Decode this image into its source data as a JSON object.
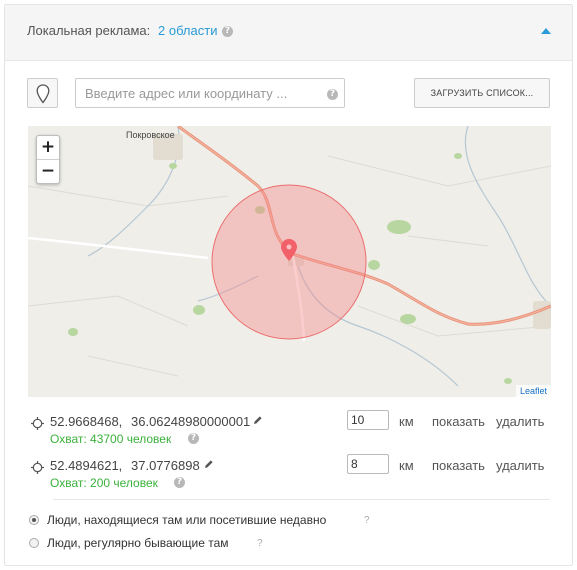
{
  "header": {
    "title": "Локальная реклама:",
    "regions_link": "2 области",
    "help_icon": "?",
    "collapse_icon": "chevron-up-icon"
  },
  "toolbar": {
    "pin_icon": "map-pin-icon",
    "search_placeholder": "Введите адрес или координату ...",
    "search_value": "",
    "search_help": "?",
    "upload_label": "ЗАГРУЗИТЬ СПИСОК..."
  },
  "map": {
    "zoom_in": "+",
    "zoom_out": "−",
    "place_label": "Покровское",
    "attribution": "Leaflet",
    "circle_color": "#f28b8b",
    "marker_color": "#f2606a"
  },
  "locations": [
    {
      "lat": "52.9668468,",
      "lng": "36.06248980000001",
      "reach": "Охват: 43700 человек",
      "radius": "10",
      "unit": "км",
      "show": "показать",
      "delete": "удалить"
    },
    {
      "lat": "52.4894621,",
      "lng": "37.0776898",
      "reach": "Охват: 200 человек",
      "radius": "8",
      "unit": "км",
      "show": "показать",
      "delete": "удалить"
    }
  ],
  "audience": {
    "options": [
      {
        "label": "Люди, находящиеся там или посетившие недавно",
        "help": "?",
        "selected": true
      },
      {
        "label": "Люди, регулярно бывающие там",
        "help": "?",
        "selected": false
      }
    ]
  },
  "colors": {
    "accent": "#2a9bd6",
    "reach": "#3bb13b"
  }
}
